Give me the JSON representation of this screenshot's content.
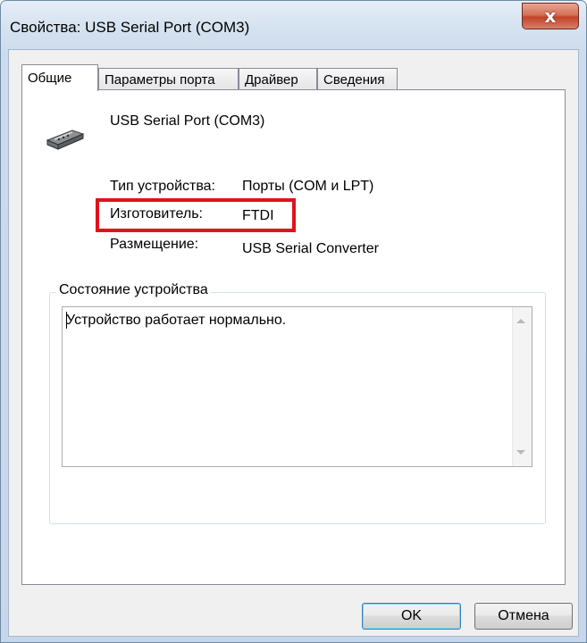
{
  "window": {
    "title": "Свойства: USB Serial Port (COM3)",
    "close_symbol": "x"
  },
  "tabs": [
    {
      "label": "Общие",
      "active": true
    },
    {
      "label": "Параметры порта",
      "active": false
    },
    {
      "label": "Драйвер",
      "active": false
    },
    {
      "label": "Сведения",
      "active": false
    }
  ],
  "device": {
    "icon": "serial-port-connector-icon",
    "name": "USB Serial Port (COM3)",
    "type_label": "Тип устройства:",
    "type_value": "Порты (COM и LPT)",
    "manufacturer_label": "Изготовитель:",
    "manufacturer_value": "FTDI",
    "location_label": "Размещение:",
    "location_value": "USB Serial Converter"
  },
  "status": {
    "group_title": "Состояние устройства",
    "text": "Устройство работает нормально."
  },
  "buttons": {
    "ok": "OK",
    "cancel": "Отмена"
  },
  "colors": {
    "highlight": "#e0121b",
    "close_button": "#c2442a"
  }
}
